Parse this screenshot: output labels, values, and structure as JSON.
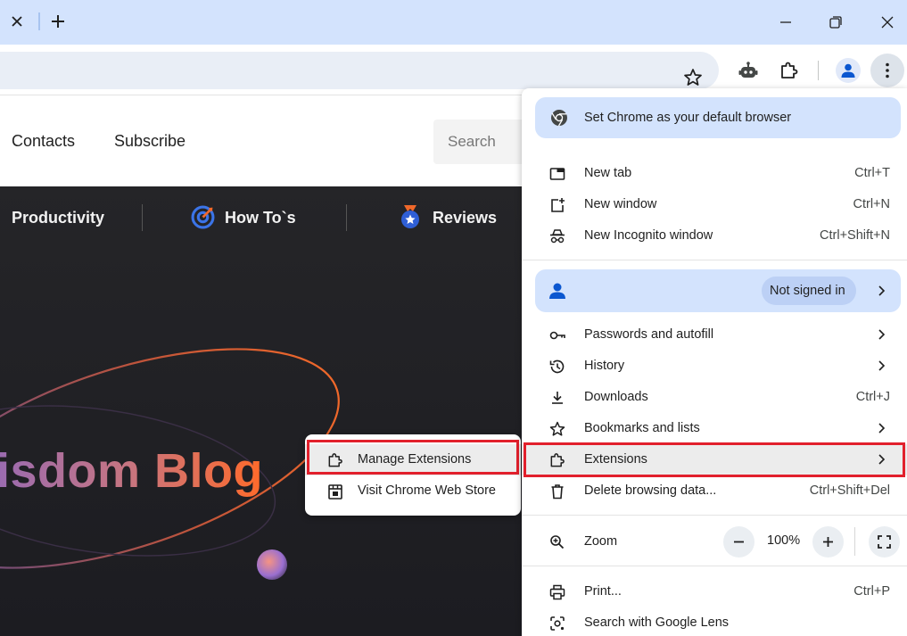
{
  "window": {
    "controls": [
      "minimize-icon",
      "restore-icon",
      "close-icon"
    ]
  },
  "tabstrip": {
    "close_icon": "close-icon",
    "new_tab_icon": "plus-icon"
  },
  "toolbar": {
    "icons": [
      "star-icon",
      "robot-icon",
      "puzzle-icon",
      "profile-icon",
      "more-vert-icon"
    ]
  },
  "website": {
    "nav": [
      "Contacts",
      "Subscribe"
    ],
    "search_placeholder": "Search",
    "categories": [
      "Productivity",
      "How To`s",
      "Reviews"
    ],
    "hero_title": "isdom Blog"
  },
  "chrome_menu": {
    "promo": "Set Chrome as your default browser",
    "group1": [
      {
        "label": "New tab",
        "shortcut": "Ctrl+T",
        "icon": "new-tab-icon"
      },
      {
        "label": "New window",
        "shortcut": "Ctrl+N",
        "icon": "new-window-icon"
      },
      {
        "label": "New Incognito window",
        "shortcut": "Ctrl+Shift+N",
        "icon": "incognito-icon"
      }
    ],
    "profile": {
      "status": "Not signed in"
    },
    "group2": [
      {
        "label": "Passwords and autofill",
        "shortcut": "",
        "icon": "key-icon",
        "submenu": true
      },
      {
        "label": "History",
        "shortcut": "",
        "icon": "history-icon",
        "submenu": true
      },
      {
        "label": "Downloads",
        "shortcut": "Ctrl+J",
        "icon": "download-icon",
        "submenu": false
      },
      {
        "label": "Bookmarks and lists",
        "shortcut": "",
        "icon": "star-icon",
        "submenu": true
      },
      {
        "label": "Extensions",
        "shortcut": "",
        "icon": "puzzle-icon",
        "submenu": true,
        "highlighted": true
      },
      {
        "label": "Delete browsing data...",
        "shortcut": "Ctrl+Shift+Del",
        "icon": "trash-icon",
        "submenu": false
      }
    ],
    "zoom": {
      "label": "Zoom",
      "value": "100%",
      "minus": "−",
      "plus": "+"
    },
    "group3": [
      {
        "label": "Print...",
        "shortcut": "Ctrl+P",
        "icon": "printer-icon"
      },
      {
        "label": "Search with Google Lens",
        "shortcut": "",
        "icon": "lens-icon"
      }
    ]
  },
  "extensions_submenu": {
    "items": [
      {
        "label": "Manage Extensions",
        "icon": "puzzle-icon",
        "highlighted": true
      },
      {
        "label": "Visit Chrome Web Store",
        "icon": "web-store-icon"
      }
    ]
  },
  "colors": {
    "highlight_border": "#e2202c",
    "titlebar": "#d3e3fd",
    "accent": "#0b57d0"
  }
}
